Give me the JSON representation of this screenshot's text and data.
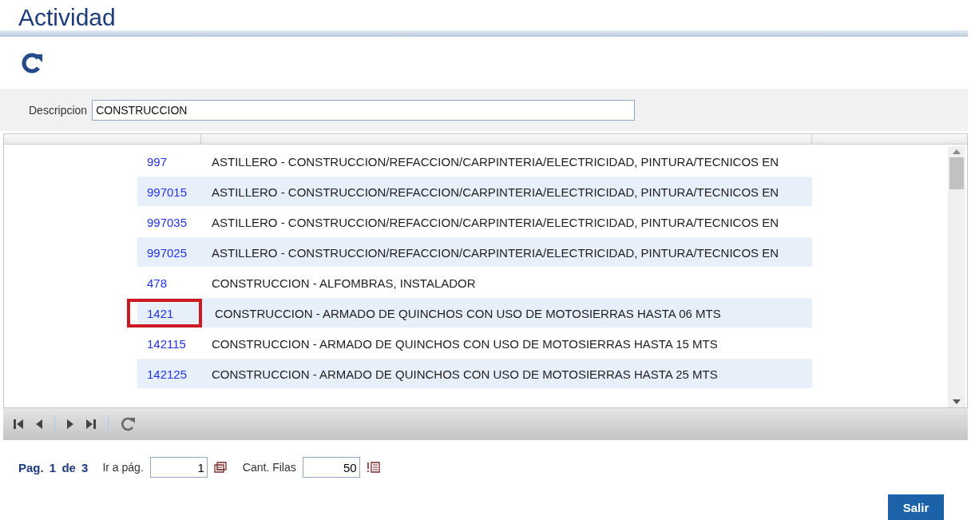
{
  "title": "Actividad",
  "filter": {
    "label": "Descripcion",
    "value": "CONSTRUCCION"
  },
  "rows": [
    {
      "code": "997",
      "description": "ASTILLERO - CONSTRUCCION/REFACCION/CARPINTERIA/ELECTRICIDAD, PINTURA/TECNICOS EN",
      "outlined": false
    },
    {
      "code": "997015",
      "description": "ASTILLERO - CONSTRUCCION/REFACCION/CARPINTERIA/ELECTRICIDAD, PINTURA/TECNICOS EN",
      "outlined": false
    },
    {
      "code": "997035",
      "description": "ASTILLERO - CONSTRUCCION/REFACCION/CARPINTERIA/ELECTRICIDAD, PINTURA/TECNICOS EN",
      "outlined": false
    },
    {
      "code": "997025",
      "description": "ASTILLERO - CONSTRUCCION/REFACCION/CARPINTERIA/ELECTRICIDAD, PINTURA/TECNICOS EN",
      "outlined": false
    },
    {
      "code": "478",
      "description": "CONSTRUCCION - ALFOMBRAS, INSTALADOR",
      "outlined": false
    },
    {
      "code": "1421",
      "description": "CONSTRUCCION - ARMADO DE QUINCHOS CON USO DE MOTOSIERRAS HASTA 06 MTS",
      "outlined": true
    },
    {
      "code": "142115",
      "description": "CONSTRUCCION - ARMADO DE QUINCHOS CON USO DE MOTOSIERRAS HASTA 15 MTS",
      "outlined": false
    },
    {
      "code": "142125",
      "description": "CONSTRUCCION - ARMADO DE QUINCHOS CON USO DE MOTOSIERRAS HASTA 25 MTS",
      "outlined": false
    }
  ],
  "pager": {
    "page_label": "Pag.",
    "page": "1",
    "of_label": "de",
    "total": "3",
    "goto_label": "Ir a pág.",
    "goto_value": "1",
    "rows_label": "Cant. Filas",
    "rows_value": "50"
  },
  "exit_button": "Salir"
}
